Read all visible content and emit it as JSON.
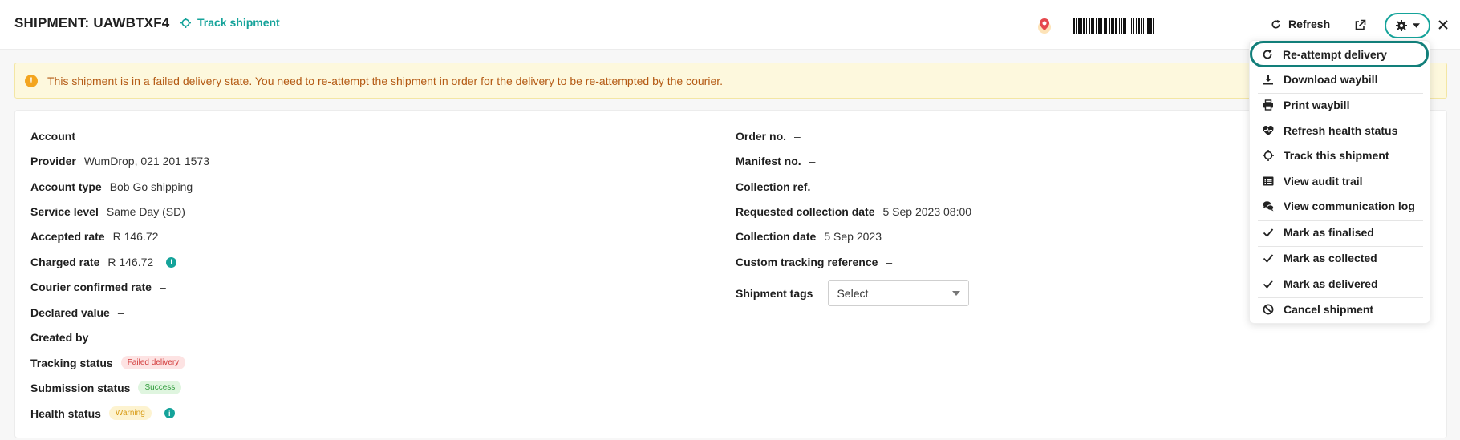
{
  "header": {
    "title": "SHIPMENT: UAWBTXF4",
    "track_link": "Track shipment",
    "refresh_label": "Refresh",
    "accent_color": "#15a39a"
  },
  "alert": {
    "text": "This shipment is in a failed delivery state. You need to re-attempt the shipment in order for the delivery to be re-attempted by the courier.",
    "icon": "!"
  },
  "details_left": {
    "account": {
      "label": "Account",
      "value": ""
    },
    "provider": {
      "label": "Provider",
      "value": "WumDrop, 021 201 1573"
    },
    "account_type": {
      "label": "Account type",
      "value": "Bob Go shipping"
    },
    "service_level": {
      "label": "Service level",
      "value": "Same Day (SD)"
    },
    "accepted_rate": {
      "label": "Accepted rate",
      "value": "R 146.72"
    },
    "charged_rate": {
      "label": "Charged rate",
      "value": "R 146.72"
    },
    "courier_confirmed_rate": {
      "label": "Courier confirmed rate",
      "value": "–"
    },
    "declared_value": {
      "label": "Declared value",
      "value": "–"
    },
    "created_by": {
      "label": "Created by",
      "value": ""
    },
    "tracking_status": {
      "label": "Tracking status",
      "badge": "Failed delivery"
    },
    "submission_status": {
      "label": "Submission status",
      "badge": "Success"
    },
    "health_status": {
      "label": "Health status",
      "badge": "Warning"
    }
  },
  "details_right": {
    "order_no": {
      "label": "Order no.",
      "value": "–"
    },
    "manifest_no": {
      "label": "Manifest no.",
      "value": "–"
    },
    "collection_ref": {
      "label": "Collection ref.",
      "value": "–"
    },
    "requested_collection_date": {
      "label": "Requested collection date",
      "value": "5 Sep 2023 08:00"
    },
    "collection_date": {
      "label": "Collection date",
      "value": "5 Sep 2023"
    },
    "custom_tracking_reference": {
      "label": "Custom tracking reference",
      "value": "–"
    },
    "shipment_tags": {
      "label": "Shipment tags",
      "placeholder": "Select"
    }
  },
  "menu": {
    "items": [
      {
        "label": "Re-attempt delivery",
        "icon": "redo-icon"
      },
      {
        "label": "Download waybill",
        "icon": "download-icon"
      },
      {
        "label": "Print waybill",
        "icon": "printer-icon"
      },
      {
        "label": "Refresh health status",
        "icon": "heart-pulse-icon"
      },
      {
        "label": "Track this shipment",
        "icon": "crosshair-icon"
      },
      {
        "label": "View audit trail",
        "icon": "list-icon"
      },
      {
        "label": "View communication log",
        "icon": "chat-icon"
      },
      {
        "label": "Mark as finalised",
        "icon": "check-icon"
      },
      {
        "label": "Mark as collected",
        "icon": "check-icon"
      },
      {
        "label": "Mark as delivered",
        "icon": "check-icon"
      },
      {
        "label": "Cancel shipment",
        "icon": "ban-icon"
      }
    ]
  }
}
